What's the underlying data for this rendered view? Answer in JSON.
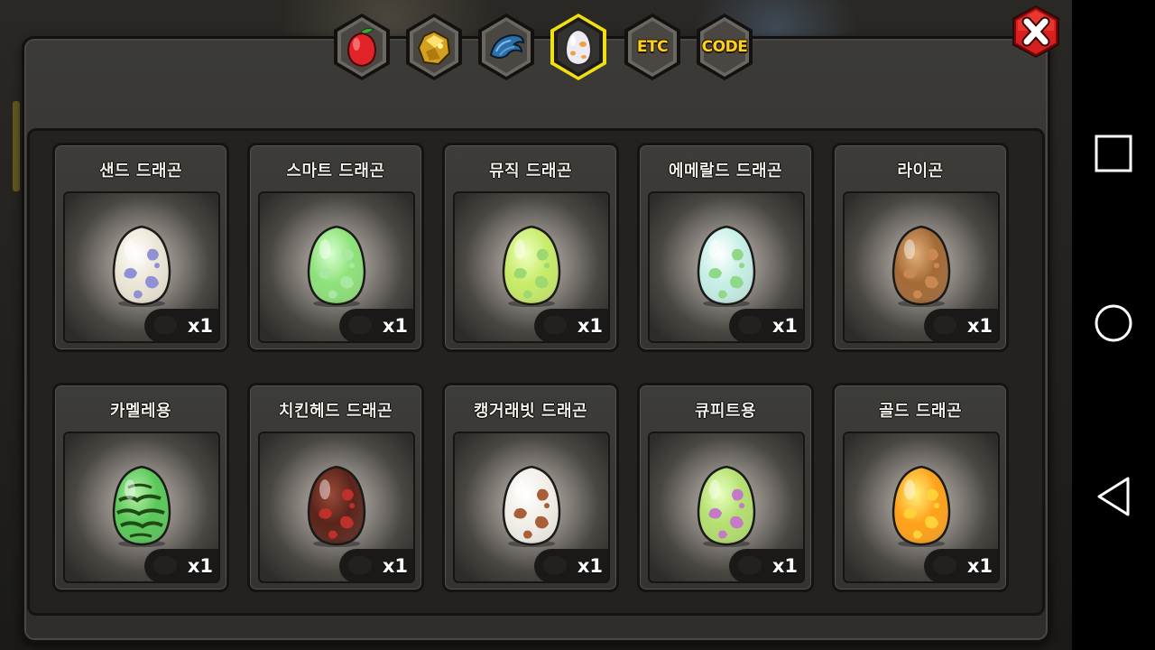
{
  "tabs": [
    {
      "name": "tab-fruit",
      "icon": "red-fruit-icon",
      "active": false
    },
    {
      "name": "tab-ore",
      "icon": "gold-ore-icon",
      "active": false
    },
    {
      "name": "tab-scale",
      "icon": "blue-scale-icon",
      "active": false
    },
    {
      "name": "tab-egg",
      "icon": "egg-icon",
      "active": true
    },
    {
      "name": "tab-etc",
      "label": "ETC",
      "active": false
    },
    {
      "name": "tab-code",
      "label": "CODE",
      "active": false
    }
  ],
  "colors": {
    "accent": "#ffd21a",
    "close": "#d81e1e",
    "active_tab_border": "#f0e010"
  },
  "eggs": [
    {
      "name": "샌드 드래곤",
      "qty": "x1",
      "base": "#ece6d6",
      "spot": "#8f90d6",
      "light": "#ffffff"
    },
    {
      "name": "스마트 드래곤",
      "qty": "x1",
      "base": "#8ee27a",
      "spot": "#a8e8a0",
      "light": "#d8ffd0"
    },
    {
      "name": "뮤직 드래곤",
      "qty": "x1",
      "base": "#c8ec6a",
      "spot": "#9ed870",
      "light": "#efffc0"
    },
    {
      "name": "에메랄드 드래곤",
      "qty": "x1",
      "base": "#c6efe6",
      "spot": "#8fd88a",
      "light": "#ffffff"
    },
    {
      "name": "라이곤",
      "qty": "x1",
      "base": "#a46a36",
      "spot": "#c88a52",
      "light": "#e2b07a"
    },
    {
      "name": "카멜레용",
      "qty": "x1",
      "base": "#5ac85a",
      "spot": "#1f4a16",
      "light": "#b8f0a8"
    },
    {
      "name": "치킨헤드 드래곤",
      "qty": "x1",
      "base": "#5a241a",
      "spot": "#c0302a",
      "light": "#9a4a3a"
    },
    {
      "name": "캥거래빗 드래곤",
      "qty": "x1",
      "base": "#f2eee8",
      "spot": "#a85e36",
      "light": "#ffffff"
    },
    {
      "name": "큐피트용",
      "qty": "x1",
      "base": "#b4e070",
      "spot": "#c47ac6",
      "light": "#e8ffc0"
    },
    {
      "name": "골드 드래곤",
      "qty": "x1",
      "base": "#ffa21a",
      "spot": "#ffd23a",
      "light": "#fff07a"
    }
  ]
}
